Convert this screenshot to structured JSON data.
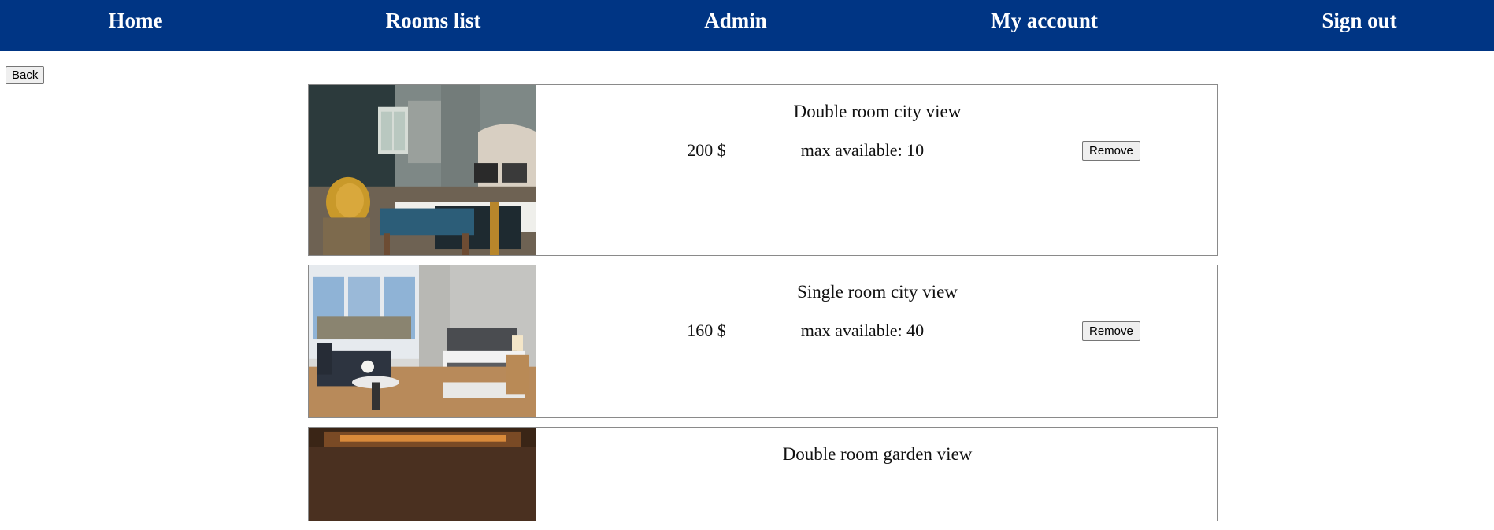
{
  "nav": {
    "items": [
      {
        "label": "Home"
      },
      {
        "label": "Rooms list"
      },
      {
        "label": "Admin"
      },
      {
        "label": "My account"
      },
      {
        "label": "Sign out"
      }
    ]
  },
  "back_label": "Back",
  "rooms": [
    {
      "title": "Double room city view",
      "price": "200 $",
      "availability": "max available: 10",
      "remove_label": "Remove"
    },
    {
      "title": "Single room city view",
      "price": "160 $",
      "availability": "max available: 40",
      "remove_label": "Remove"
    },
    {
      "title": "Double room garden view",
      "price": "",
      "availability": "",
      "remove_label": ""
    }
  ],
  "colors": {
    "navbar": "#003584",
    "nav_text": "#ffffff"
  }
}
